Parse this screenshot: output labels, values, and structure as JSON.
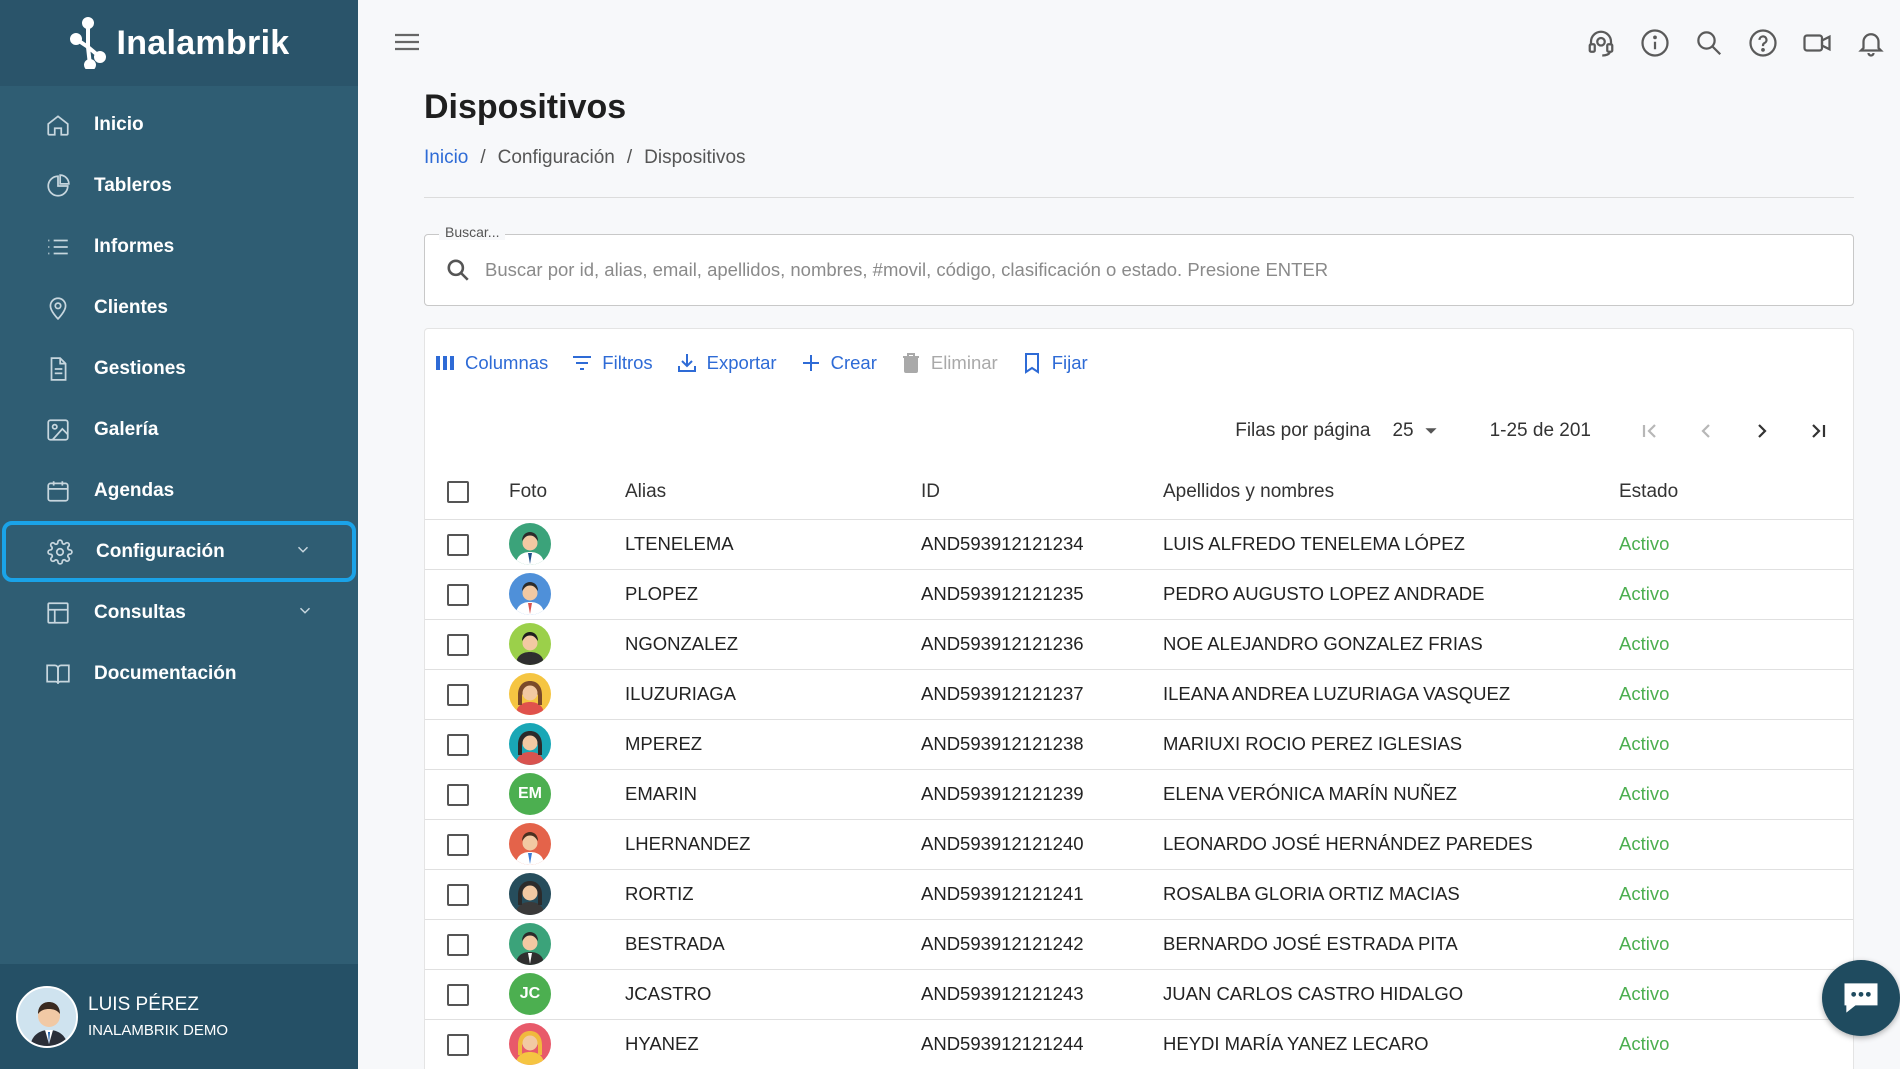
{
  "brand": {
    "name": "Inalambrik"
  },
  "sidebar": {
    "items": [
      {
        "label": "Inicio",
        "icon": "home-icon"
      },
      {
        "label": "Tableros",
        "icon": "pie-chart-icon"
      },
      {
        "label": "Informes",
        "icon": "list-icon"
      },
      {
        "label": "Clientes",
        "icon": "map-pin-icon"
      },
      {
        "label": "Gestiones",
        "icon": "document-icon"
      },
      {
        "label": "Galería",
        "icon": "image-icon"
      },
      {
        "label": "Agendas",
        "icon": "calendar-icon"
      },
      {
        "label": "Configuración",
        "icon": "gear-icon",
        "selected": true,
        "expandable": true
      },
      {
        "label": "Consultas",
        "icon": "table-icon",
        "expandable": true
      },
      {
        "label": "Documentación",
        "icon": "book-icon"
      }
    ],
    "user": {
      "name": "LUIS PÉREZ",
      "org": "INALAMBRIK DEMO"
    }
  },
  "header": {
    "icons": [
      "support-agent-icon",
      "info-icon",
      "search-icon",
      "help-icon",
      "video-icon",
      "bell-icon"
    ]
  },
  "page": {
    "title": "Dispositivos",
    "breadcrumb": [
      "Inicio",
      "Configuración",
      "Dispositivos"
    ]
  },
  "search": {
    "legend": "Buscar...",
    "placeholder": "Buscar por id, alias, email, apellidos, nombres, #movil, código, clasificación o estado. Presione ENTER"
  },
  "toolbar": {
    "columns": "Columnas",
    "filters": "Filtros",
    "export": "Exportar",
    "create": "Crear",
    "delete": "Eliminar",
    "pin": "Fijar"
  },
  "pagination": {
    "rows_label": "Filas por página",
    "rows_value": "25",
    "range": "1-25 de 201"
  },
  "table": {
    "headers": {
      "foto": "Foto",
      "alias": "Alias",
      "id": "ID",
      "name": "Apellidos y nombres",
      "status": "Estado"
    },
    "rows": [
      {
        "avatar": "man-green",
        "alias": "LTENELEMA",
        "id": "AND593912121234",
        "name": "LUIS ALFREDO TENELEMA LÓPEZ",
        "status": "Activo"
      },
      {
        "avatar": "man-blue",
        "alias": "PLOPEZ",
        "id": "AND593912121235",
        "name": "PEDRO AUGUSTO LOPEZ ANDRADE",
        "status": "Activo"
      },
      {
        "avatar": "man-yellowgreen",
        "alias": "NGONZALEZ",
        "id": "AND593912121236",
        "name": "NOE ALEJANDRO GONZALEZ FRIAS",
        "status": "Activo"
      },
      {
        "avatar": "woman-yellow",
        "alias": "ILUZURIAGA",
        "id": "AND593912121237",
        "name": "ILEANA ANDREA LUZURIAGA VASQUEZ",
        "status": "Activo"
      },
      {
        "avatar": "woman-teal",
        "alias": "MPEREZ",
        "id": "AND593912121238",
        "name": "MARIUXI ROCIO PEREZ IGLESIAS",
        "status": "Activo"
      },
      {
        "avatar": "initials",
        "initials": "EM",
        "alias": "EMARIN",
        "id": "AND593912121239",
        "name": "ELENA VERÓNICA MARÍN NUÑEZ",
        "status": "Activo"
      },
      {
        "avatar": "man-red-beard",
        "alias": "LHERNANDEZ",
        "id": "AND593912121240",
        "name": "LEONARDO JOSÉ HERNÁNDEZ PAREDES",
        "status": "Activo"
      },
      {
        "avatar": "woman-dark",
        "alias": "RORTIZ",
        "id": "AND593912121241",
        "name": "ROSALBA GLORIA ORTIZ MACIAS",
        "status": "Activo"
      },
      {
        "avatar": "man-mustache",
        "alias": "BESTRADA",
        "id": "AND593912121242",
        "name": "BERNARDO JOSÉ ESTRADA PITA",
        "status": "Activo"
      },
      {
        "avatar": "initials",
        "initials": "JC",
        "alias": "JCASTRO",
        "id": "AND593912121243",
        "name": "JUAN CARLOS CASTRO HIDALGO",
        "status": "Activo"
      },
      {
        "avatar": "woman-red",
        "alias": "HYANEZ",
        "id": "AND593912121244",
        "name": "HEYDI MARÍA YANEZ LECARO",
        "status": "Activo"
      }
    ]
  },
  "colors": {
    "sidebar_bg": "#2f5d73",
    "accent_blue": "#2e6bd6",
    "status_green": "#4caf50",
    "selected_outline": "#1aa3e8"
  }
}
